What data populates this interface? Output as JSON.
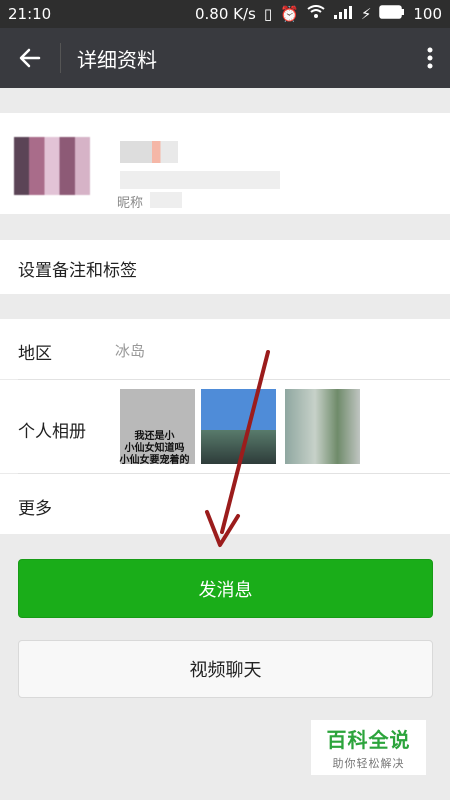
{
  "statusbar": {
    "time": "21:10",
    "speed": "0.80 K/s",
    "battery": "100"
  },
  "navbar": {
    "title": "详细资料",
    "back_icon": "back-arrow-icon",
    "more_icon": "more-vertical-icon"
  },
  "profile": {
    "nickname_label": "昵称"
  },
  "rows": {
    "remark": "设置备注和标签",
    "region_label": "地区",
    "region_value": "冰岛",
    "album_label": "个人相册",
    "album_thumb_text": "我还是小\n小仙女知道吗\n小仙女要宠着的",
    "more_label": "更多"
  },
  "buttons": {
    "message": "发消息",
    "video": "视频聊天"
  },
  "watermark": {
    "title": "百科全说",
    "subtitle": "助你轻松解决"
  },
  "colors": {
    "primary_green": "#1aad19",
    "navbar": "#393a3f",
    "annotation_arrow": "#9b1c1c"
  }
}
